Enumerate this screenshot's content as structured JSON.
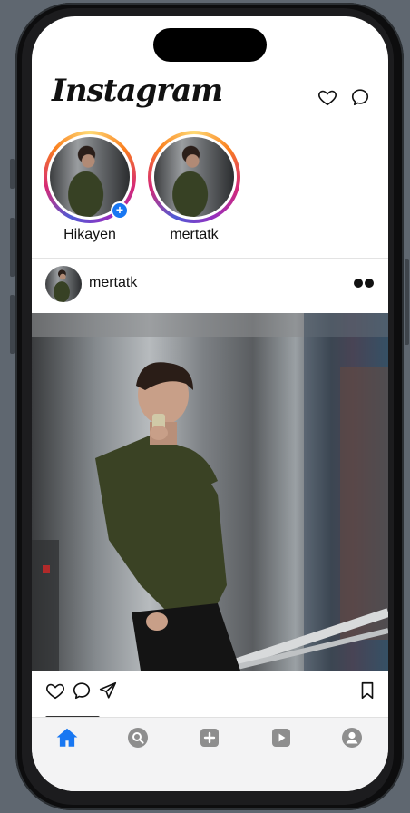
{
  "header": {
    "logo_text": "Instagram",
    "icons": [
      "heart-icon",
      "messenger-icon"
    ]
  },
  "stories": [
    {
      "label": "Hikayen",
      "is_own": true,
      "badge_icon": "plus-icon"
    },
    {
      "label": "mertatk",
      "is_own": false
    }
  ],
  "post": {
    "username": "mertatk",
    "menu_icon": "more-icon",
    "actions": [
      "heart-icon",
      "comment-icon",
      "share-icon",
      "bookmark-icon"
    ]
  },
  "tabbar": {
    "tabs": [
      {
        "name": "home",
        "icon": "home-icon",
        "active": true
      },
      {
        "name": "search",
        "icon": "search-icon",
        "active": false
      },
      {
        "name": "create",
        "icon": "add-icon",
        "active": false
      },
      {
        "name": "reels",
        "icon": "play-icon",
        "active": false
      },
      {
        "name": "profile",
        "icon": "profile-icon",
        "active": false
      }
    ]
  },
  "colors": {
    "active_tab": "#1877f2",
    "inactive_tab": "#8e8e8e",
    "badge": "#1877f2",
    "device_background": "#5f6770"
  }
}
